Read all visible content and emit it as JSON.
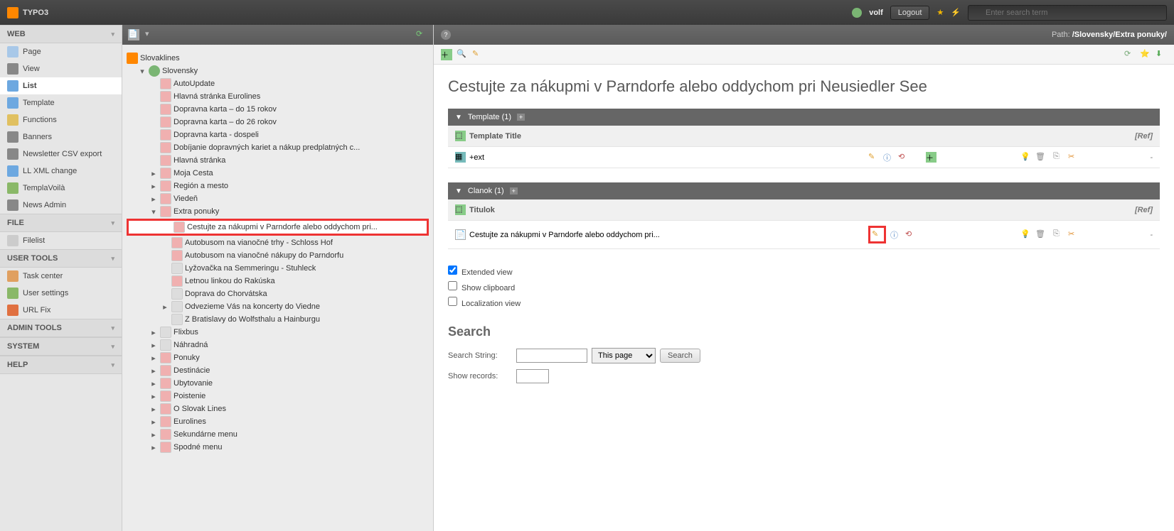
{
  "topbar": {
    "logo": "TYPO3",
    "username": "volf",
    "logout": "Logout",
    "search_placeholder": "Enter search term"
  },
  "modules": {
    "sections": [
      {
        "title": "WEB",
        "items": [
          {
            "label": "Page",
            "icon": "#a8c8e8",
            "active": false
          },
          {
            "label": "View",
            "icon": "#888",
            "active": false
          },
          {
            "label": "List",
            "icon": "#6da8e0",
            "active": true
          },
          {
            "label": "Template",
            "icon": "#6da8e0",
            "active": false
          },
          {
            "label": "Functions",
            "icon": "#e0c060",
            "active": false
          },
          {
            "label": "Banners",
            "icon": "#888",
            "active": false
          },
          {
            "label": "Newsletter CSV export",
            "icon": "#888",
            "active": false
          },
          {
            "label": "LL XML change",
            "icon": "#6da8e0",
            "active": false
          },
          {
            "label": "TemplaVoilà",
            "icon": "#8ab868",
            "active": false
          },
          {
            "label": "News Admin",
            "icon": "#888",
            "active": false
          }
        ]
      },
      {
        "title": "FILE",
        "items": [
          {
            "label": "Filelist",
            "icon": "#ccc",
            "active": false
          }
        ]
      },
      {
        "title": "USER TOOLS",
        "items": [
          {
            "label": "Task center",
            "icon": "#e0a060",
            "active": false
          },
          {
            "label": "User settings",
            "icon": "#8ab868",
            "active": false
          },
          {
            "label": "URL Fix",
            "icon": "#e07040",
            "active": false
          }
        ]
      },
      {
        "title": "ADMIN TOOLS",
        "items": []
      },
      {
        "title": "SYSTEM",
        "items": []
      },
      {
        "title": "HELP",
        "items": []
      }
    ]
  },
  "tree": {
    "root": "Slovaklines",
    "lang_root": "Slovensky",
    "nodes": [
      {
        "label": "AutoUpdate",
        "depth": 2,
        "exp": ""
      },
      {
        "label": "Hlavná stránka Eurolines",
        "depth": 2,
        "exp": ""
      },
      {
        "label": "Dopravna karta – do 15 rokov",
        "depth": 2,
        "exp": ""
      },
      {
        "label": "Dopravna karta – do 26 rokov",
        "depth": 2,
        "exp": ""
      },
      {
        "label": "Dopravna karta - dospeli",
        "depth": 2,
        "exp": ""
      },
      {
        "label": "Dobíjanie dopravných kariet a nákup predplatných c...",
        "depth": 2,
        "exp": ""
      },
      {
        "label": "Hlavná stránka",
        "depth": 2,
        "exp": ""
      },
      {
        "label": "Moja Cesta",
        "depth": 2,
        "exp": "▸"
      },
      {
        "label": "Región a mesto",
        "depth": 2,
        "exp": "▸"
      },
      {
        "label": "Viedeň",
        "depth": 2,
        "exp": "▸"
      },
      {
        "label": "Extra ponuky",
        "depth": 2,
        "exp": "▾"
      },
      {
        "label": "Cestujte za nákupmi v Parndorfe alebo oddychom pri...",
        "depth": 3,
        "exp": "",
        "highlighted": true
      },
      {
        "label": "Autobusom na vianočné trhy - Schloss Hof",
        "depth": 3,
        "exp": ""
      },
      {
        "label": "Autobusom na vianočné nákupy do Parndorfu",
        "depth": 3,
        "exp": ""
      },
      {
        "label": "Lyžovačka na Semmeringu - Stuhleck",
        "depth": 3,
        "exp": "",
        "plain": true
      },
      {
        "label": "Letnou linkou do Rakúska",
        "depth": 3,
        "exp": ""
      },
      {
        "label": "Doprava do Chorvátska",
        "depth": 3,
        "exp": "",
        "plain": true
      },
      {
        "label": "Odvezieme Vás na koncerty do Viedne",
        "depth": 3,
        "exp": "▸",
        "plain": true
      },
      {
        "label": "Z Bratislavy do Wolfsthalu a Hainburgu",
        "depth": 3,
        "exp": "",
        "plain": true
      },
      {
        "label": "Flixbus",
        "depth": 2,
        "exp": "▸",
        "plain": true
      },
      {
        "label": "Náhradná",
        "depth": 2,
        "exp": "▸",
        "plain": true
      },
      {
        "label": "Ponuky",
        "depth": 2,
        "exp": "▸"
      },
      {
        "label": "Destinácie",
        "depth": 2,
        "exp": "▸"
      },
      {
        "label": "Ubytovanie",
        "depth": 2,
        "exp": "▸"
      },
      {
        "label": "Poistenie",
        "depth": 2,
        "exp": "▸"
      },
      {
        "label": "O Slovak Lines",
        "depth": 2,
        "exp": "▸"
      },
      {
        "label": "Eurolines",
        "depth": 2,
        "exp": "▸"
      },
      {
        "label": "Sekundárne menu",
        "depth": 2,
        "exp": "▸"
      },
      {
        "label": "Spodné menu",
        "depth": 2,
        "exp": "▸"
      }
    ]
  },
  "docheader": {
    "path_label": "Path:",
    "path": "/Slovensky/Extra ponuky/"
  },
  "content": {
    "page_title": "Cestujte za nákupmi v Parndorfe alebo oddychom pri Neusiedler See",
    "template": {
      "header": "Template (1)",
      "col_title": "Template Title",
      "col_ref": "[Ref]",
      "rows": [
        {
          "title": "+ext",
          "ref": "-"
        }
      ]
    },
    "clanok": {
      "header": "Clanok (1)",
      "col_title": "Titulok",
      "col_ref": "[Ref]",
      "rows": [
        {
          "title": "Cestujte za nákupmi v Parndorfe alebo oddychom pri...",
          "ref": "-"
        }
      ]
    },
    "checkboxes": {
      "extended": "Extended view",
      "clipboard": "Show clipboard",
      "localization": "Localization view"
    },
    "search": {
      "heading": "Search",
      "string_label": "Search String:",
      "records_label": "Show records:",
      "scope": "This page",
      "button": "Search"
    }
  }
}
